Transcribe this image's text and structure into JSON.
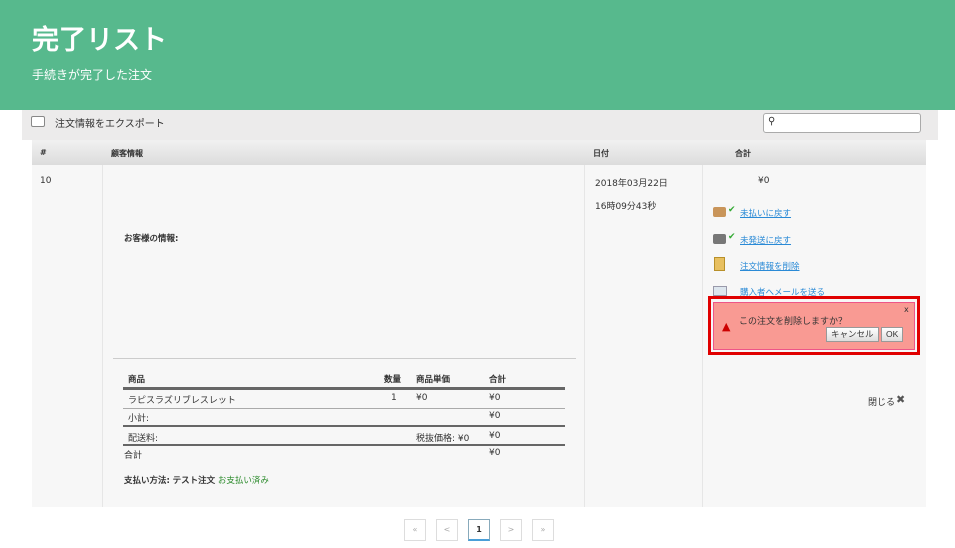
{
  "header": {
    "title": "完了リスト",
    "subtitle": "手続きが完了した注文"
  },
  "toolbar": {
    "export_label": "注文情報をエクスポート",
    "search_placeholder": ""
  },
  "table": {
    "columns": [
      "#",
      "顧客情報",
      "日付",
      "合計"
    ],
    "row": {
      "id": "10",
      "customer_label": "お客様の情報:",
      "date": "2018年03月22日",
      "time": "16時09分43秒",
      "total": "¥0",
      "actions": [
        "未払いに戻す",
        "未発送に戻す",
        "注文情報を削除",
        "購入者へメールを送る"
      ],
      "close_label": "閉じる"
    }
  },
  "order": {
    "columns": [
      "商品",
      "数量",
      "商品単価",
      "合計"
    ],
    "item": {
      "name": "ラピスラズリブレスレット",
      "qty": "1",
      "price": "¥0",
      "total": "¥0"
    },
    "subtotal_label": "小計:",
    "subtotal": "¥0",
    "shipping_label": "配送料:",
    "shipping_pretax": "税抜価格: ¥0",
    "shipping": "¥0",
    "total_label": "合計",
    "total": "¥0",
    "payment_label": "支払い方法:",
    "payment_method": "テスト注文",
    "payment_status": "お支払い済み"
  },
  "dialog": {
    "message": "この注文を削除しますか？",
    "cancel": "キャンセル",
    "ok": "OK",
    "close": "x"
  },
  "pagination": {
    "first": "«",
    "prev": "<",
    "current": "1",
    "next": ">",
    "last": "»"
  },
  "colors": {
    "header": "#57b98d",
    "dialog": "#f99a93",
    "highlight": "#e00000",
    "paid": "#2a8a2a"
  }
}
